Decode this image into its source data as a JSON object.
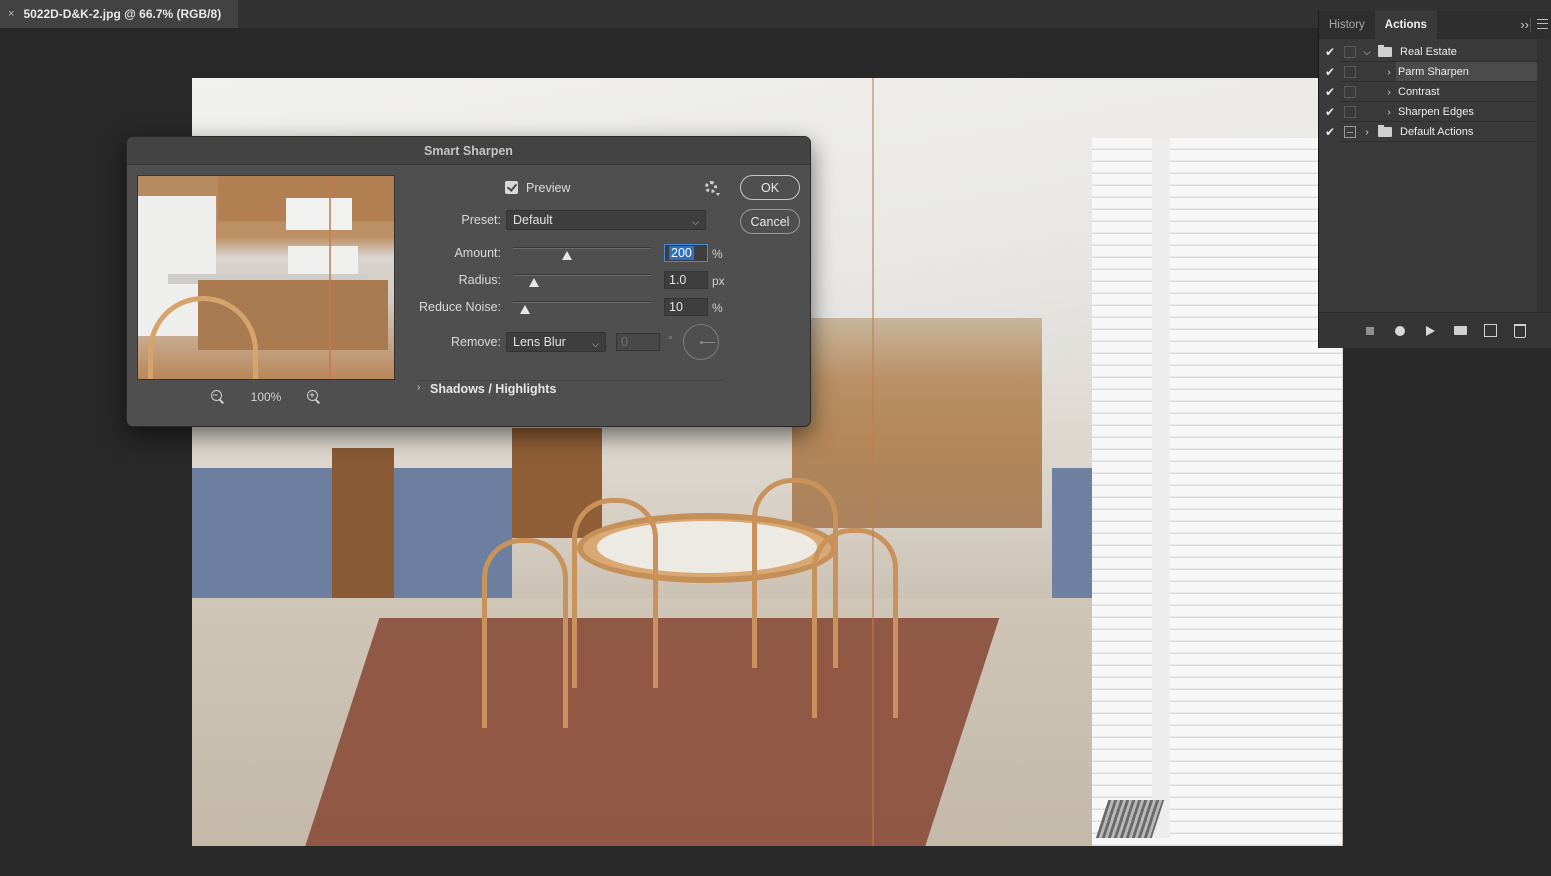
{
  "document_tab": {
    "close": "×",
    "title": "5022D-D&K-2.jpg @ 66.7% (RGB/8)"
  },
  "panel": {
    "tabs": [
      {
        "label": "History"
      },
      {
        "label": "Actions"
      }
    ],
    "collapse_glyph": "››",
    "actions": [
      {
        "label": "Real Estate",
        "type": "set",
        "checked": true,
        "expanded": true
      },
      {
        "label": "Parm Sharpen",
        "type": "action",
        "checked": true,
        "selected": true
      },
      {
        "label": "Contrast",
        "type": "action",
        "checked": true
      },
      {
        "label": "Sharpen Edges",
        "type": "action",
        "checked": true
      },
      {
        "label": "Default Actions",
        "type": "set",
        "checked": true,
        "dialog": true
      }
    ],
    "footer_icons": [
      "stop-icon",
      "record-icon",
      "play-icon",
      "new-set-icon",
      "new-action-icon",
      "trash-icon"
    ]
  },
  "dialog": {
    "title": "Smart Sharpen",
    "preview_label": "Preview",
    "preview_checked": true,
    "zoom_level": "100%",
    "ok_label": "OK",
    "cancel_label": "Cancel",
    "preset_label": "Preset:",
    "preset_value": "Default",
    "amount_label": "Amount:",
    "amount_value": "200",
    "amount_unit": "%",
    "radius_label": "Radius:",
    "radius_value": "1.0",
    "radius_unit": "px",
    "noise_label": "Reduce Noise:",
    "noise_value": "10",
    "noise_unit": "%",
    "remove_label": "Remove:",
    "remove_value": "Lens Blur",
    "angle_value": "0",
    "angle_unit": "°",
    "shadows_label": "Shadows / Highlights"
  }
}
